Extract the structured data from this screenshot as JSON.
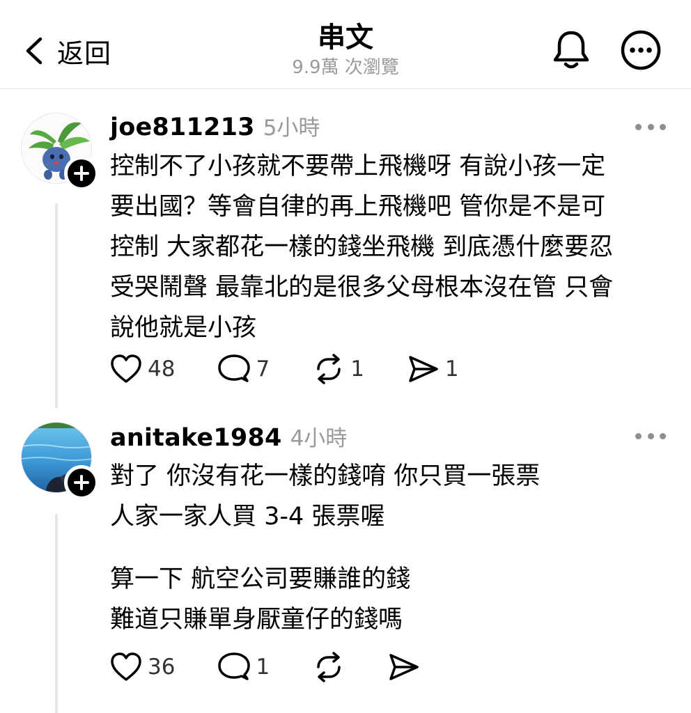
{
  "header": {
    "back_label": "返回",
    "title": "串文",
    "subtitle": "9.9萬 次瀏覽"
  },
  "posts": [
    {
      "username": "joe811213",
      "time": "5小時",
      "lines": [
        "控制不了小孩就不要帶上飛機呀 有說小孩一定",
        "要出國？等會自律的再上飛機吧 管你是不是可",
        "控制 大家都花一樣的錢坐飛機 到底憑什麼要忍",
        "受哭鬧聲 最靠北的是很多父母根本沒在管 只會",
        "說他就是小孩"
      ],
      "likes": "48",
      "comments": "7",
      "reposts": "1",
      "shares": "1"
    },
    {
      "username": "anitake1984",
      "time": "4小時",
      "lines": [
        "對了 你沒有花一樣的錢唷 你只買一張票",
        "人家一家人買 3-4 張票喔",
        "算一下 航空公司要賺誰的錢",
        "難道只賺單身厭童仔的錢嗎"
      ],
      "likes": "36",
      "comments": "1"
    }
  ],
  "icons": {
    "back": "chevron-left-icon",
    "bell": "bell-icon",
    "more": "more-icon",
    "like": "heart-icon",
    "comment": "comment-icon",
    "repost": "repost-icon",
    "share": "send-icon"
  }
}
